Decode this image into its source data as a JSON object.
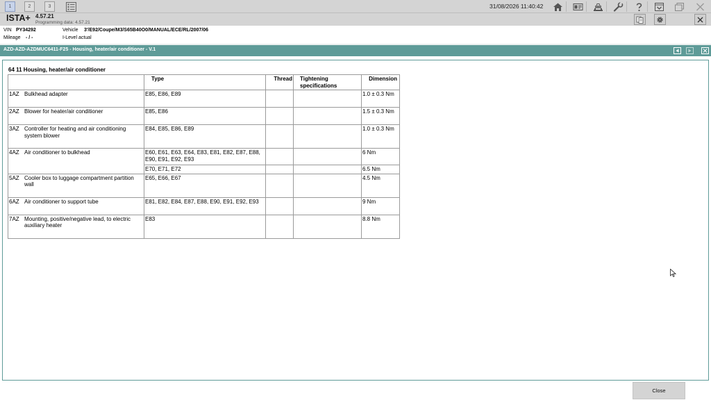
{
  "topbar": {
    "tabs": [
      "1",
      "2",
      "3"
    ],
    "datetime": "31/08/2026 11:40:42"
  },
  "header": {
    "brand": "ISTA+",
    "version": "4.57.21",
    "programming_data": "Programming data:  4.57.21"
  },
  "vehicle": {
    "vin_label": "VIN",
    "vin": "PY34292",
    "vehicle_label": "Vehicle",
    "vehicle": "3'/E92/Coupe/M3/S65B40O0/MANUAL/ECE/RL/2007/06",
    "mileage_label": "Mileage",
    "mileage": "- / -",
    "ilevel": "I-Level actual"
  },
  "document": {
    "title": "AZD-AZD-AZDMUC6411-F25 - Housing, heater/air conditioner - V.1",
    "section_title": "64 11 Housing, heater/air conditioner",
    "columns": {
      "type": "Type",
      "thread": "Thread",
      "tightening": "Tightening specifications",
      "dimension": "Dimension"
    },
    "rows": [
      {
        "code": "1AZ",
        "name": "Bulkhead adapter",
        "entries": [
          {
            "type": "E85, E86, E89",
            "dimension": "1.0 ± 0.3 Nm"
          }
        ]
      },
      {
        "code": "2AZ",
        "name": "Blower for heater/air conditioner",
        "entries": [
          {
            "type": "E85, E86",
            "dimension": "1.5 ± 0.3 Nm"
          }
        ]
      },
      {
        "code": "3AZ",
        "name": "Controller for heating and air conditioning system blower",
        "entries": [
          {
            "type": "E84, E85, E86, E89",
            "dimension": "1.0 ± 0.3 Nm"
          }
        ]
      },
      {
        "code": "4AZ",
        "name": "Air conditioner to bulkhead",
        "entries": [
          {
            "type": "E60, E61, E63, E64, E83, E81, E82, E87, E88, E90, E91, E92, E93",
            "dimension": "6 Nm"
          },
          {
            "type": "E70, E71, E72",
            "dimension": "6.5 Nm"
          }
        ]
      },
      {
        "code": "5AZ",
        "name": "Cooler box to luggage compartment partition wall",
        "entries": [
          {
            "type": "E65, E66, E67",
            "dimension": "4.5 Nm"
          }
        ]
      },
      {
        "code": "6AZ",
        "name": "Air conditioner to support tube",
        "entries": [
          {
            "type": "E81, E82, E84, E87, E88, E90, E91, E92, E93",
            "dimension": "9 Nm"
          }
        ]
      },
      {
        "code": "7AZ",
        "name": "Mounting, positive/negative lead, to electric auxiliary heater",
        "entries": [
          {
            "type": "E83",
            "dimension": "8.8 Nm"
          }
        ]
      }
    ]
  },
  "footer": {
    "close_label": "Close"
  },
  "colors": {
    "titlebar": "#5e9b98",
    "chrome": "#d4d4d4"
  },
  "icons": [
    "list-icon",
    "home-icon",
    "id-card-icon",
    "vehicle-lift-icon",
    "wrench-icon",
    "help-icon",
    "minimize-icon",
    "window-icon",
    "close-icon",
    "notes-icon",
    "gear-icon",
    "arrow-left-icon",
    "arrow-right-icon",
    "mouse-cursor-icon"
  ]
}
